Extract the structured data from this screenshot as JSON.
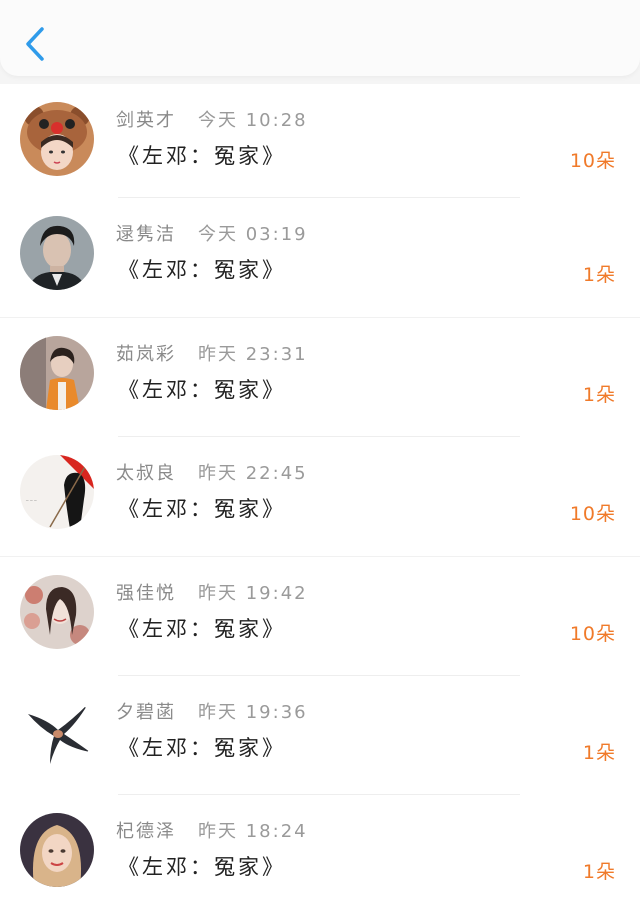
{
  "header": {
    "back_icon": "chevron-left-icon",
    "accent_color": "#2f9bea"
  },
  "items": [
    {
      "name": "剑英才",
      "time": "今天 10:28",
      "book": "《左邓：冤家》",
      "count": "10朵",
      "avatar": "bear-hood-girl"
    },
    {
      "name": "逯隽洁",
      "time": "今天 03:19",
      "book": "《左邓：冤家》",
      "count": "1朵",
      "avatar": "dark-hair-man"
    },
    {
      "name": "茹岚彩",
      "time": "昨天 23:31",
      "book": "《左邓：冤家》",
      "count": "1朵",
      "avatar": "boy-orange-shirt"
    },
    {
      "name": "太叔良",
      "time": "昨天 22:45",
      "book": "《左邓：冤家》",
      "count": "10朵",
      "avatar": "red-umbrella-girl"
    },
    {
      "name": "强佳悦",
      "time": "昨天 19:42",
      "book": "《左邓：冤家》",
      "count": "10朵",
      "avatar": "girl-with-flowers"
    },
    {
      "name": "夕碧菡",
      "time": "昨天 19:36",
      "book": "《左邓：冤家》",
      "count": "1朵",
      "avatar": "swallow-bird"
    },
    {
      "name": "杞德泽",
      "time": "昨天 18:24",
      "book": "《左邓：冤家》",
      "count": "1朵",
      "avatar": "curly-hair-woman"
    }
  ],
  "colors": {
    "count": "#f07a2a",
    "name": "#8a8a8a",
    "book": "#222222"
  }
}
